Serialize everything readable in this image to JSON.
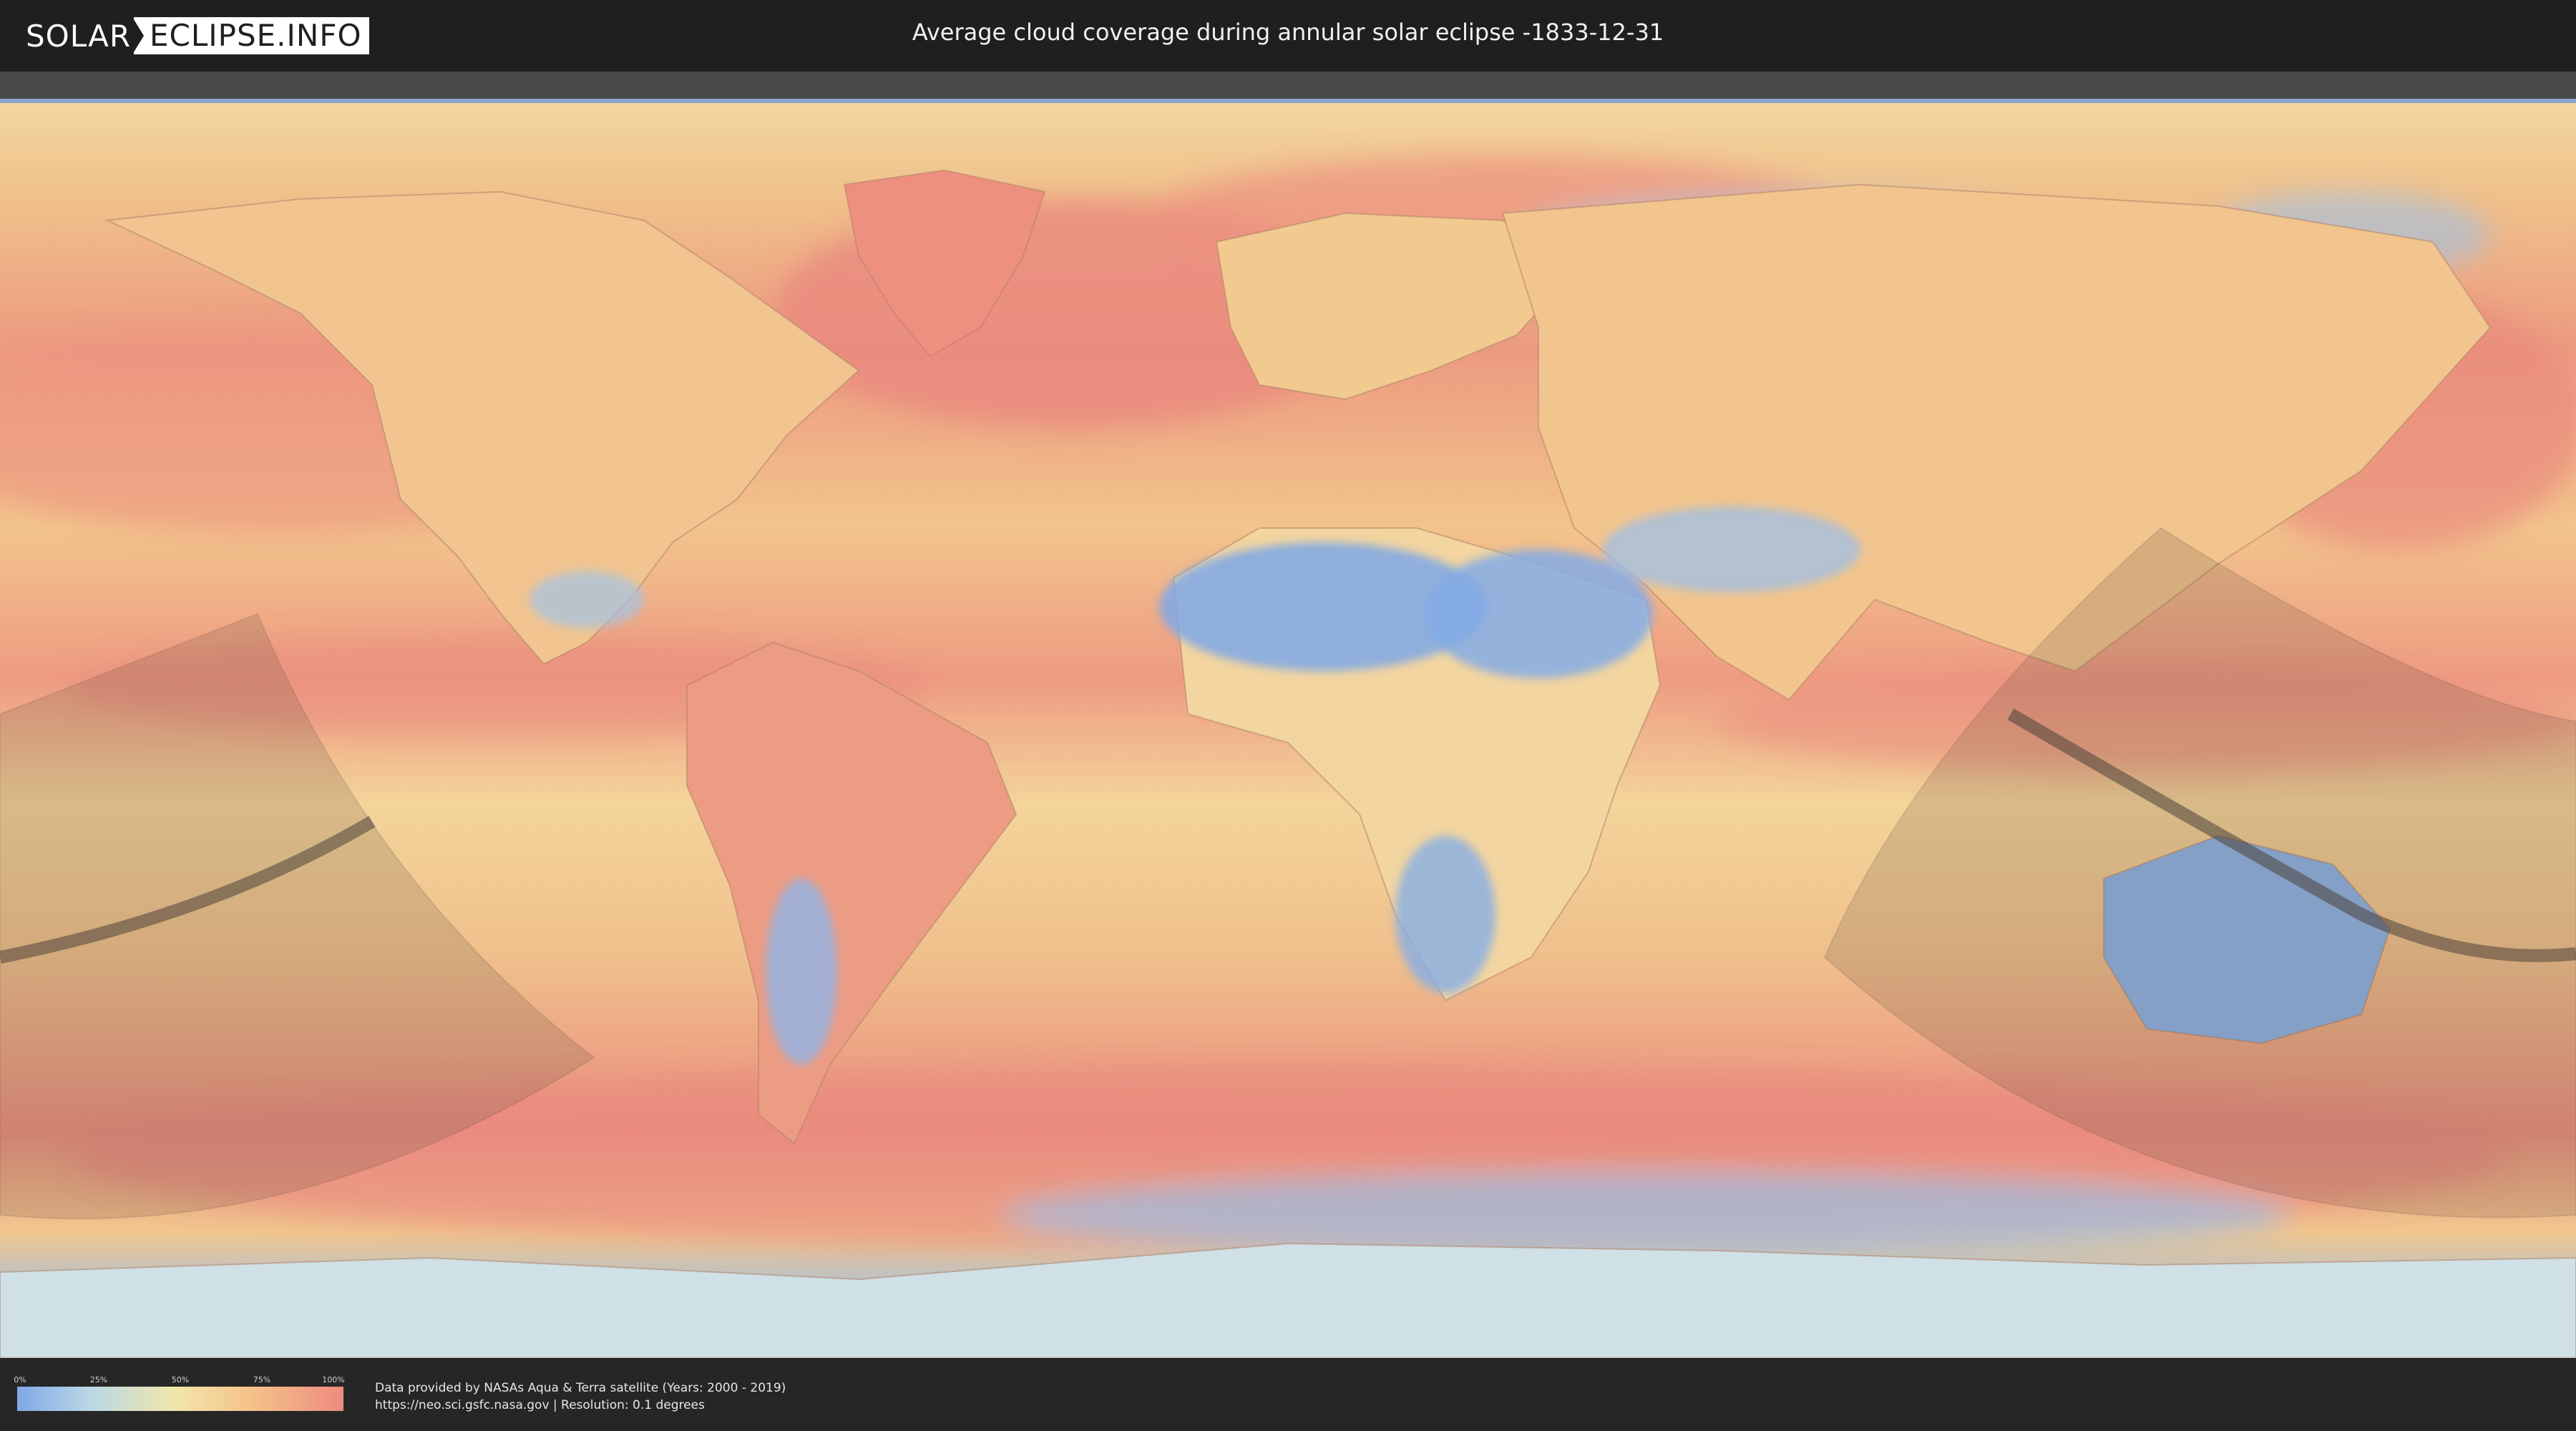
{
  "header": {
    "logo_part1": "SOLAR",
    "logo_part2": "ECLIPSE.INFO",
    "title": "Average cloud coverage during annular solar eclipse -1833-12-31"
  },
  "legend": {
    "ticks": [
      "0%",
      "25%",
      "50%",
      "75%",
      "100%"
    ],
    "colors": [
      "#7ea8e6",
      "#b9d7e6",
      "#f1e6ab",
      "#f4c289",
      "#ee8a80"
    ]
  },
  "footer": {
    "line1": "Data provided by NASAs Aqua & Terra satellite (Years: 2000 - 2019)",
    "line2": "https://neo.sci.gsfc.nasa.gov | Resolution: 0.1 degrees"
  },
  "map": {
    "projection": "equirectangular",
    "eclipse_type": "annular"
  }
}
